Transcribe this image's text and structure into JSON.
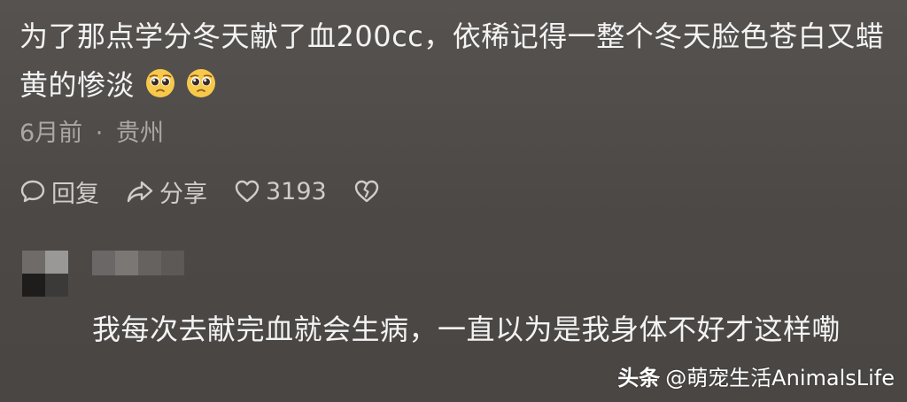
{
  "comment": {
    "text": "为了那点学分冬天献了血200cc，依稀记得一整个冬天脸色苍白又蜡黄的惨淡",
    "emojis": [
      "pleading-face-icon",
      "pleading-face-icon"
    ],
    "time": "6月前",
    "separator": "·",
    "location": "贵州"
  },
  "actions": {
    "reply_label": "回复",
    "share_label": "分享",
    "like_count": "3193",
    "reply_icon": "chat-bubble-icon",
    "share_icon": "share-arrow-icon",
    "like_icon": "heart-icon",
    "dislike_icon": "broken-heart-icon"
  },
  "reply": {
    "text": "我每次去献完血就会生病，一直以为是我身体不好才这样嘞"
  },
  "watermark": {
    "brand": "头条",
    "account": "@萌宠生活AnimalsLife"
  },
  "colors": {
    "background": "#514d4b",
    "text": "#f3f3f3",
    "meta": "#aaa7a4",
    "action": "#cfcdcb"
  }
}
